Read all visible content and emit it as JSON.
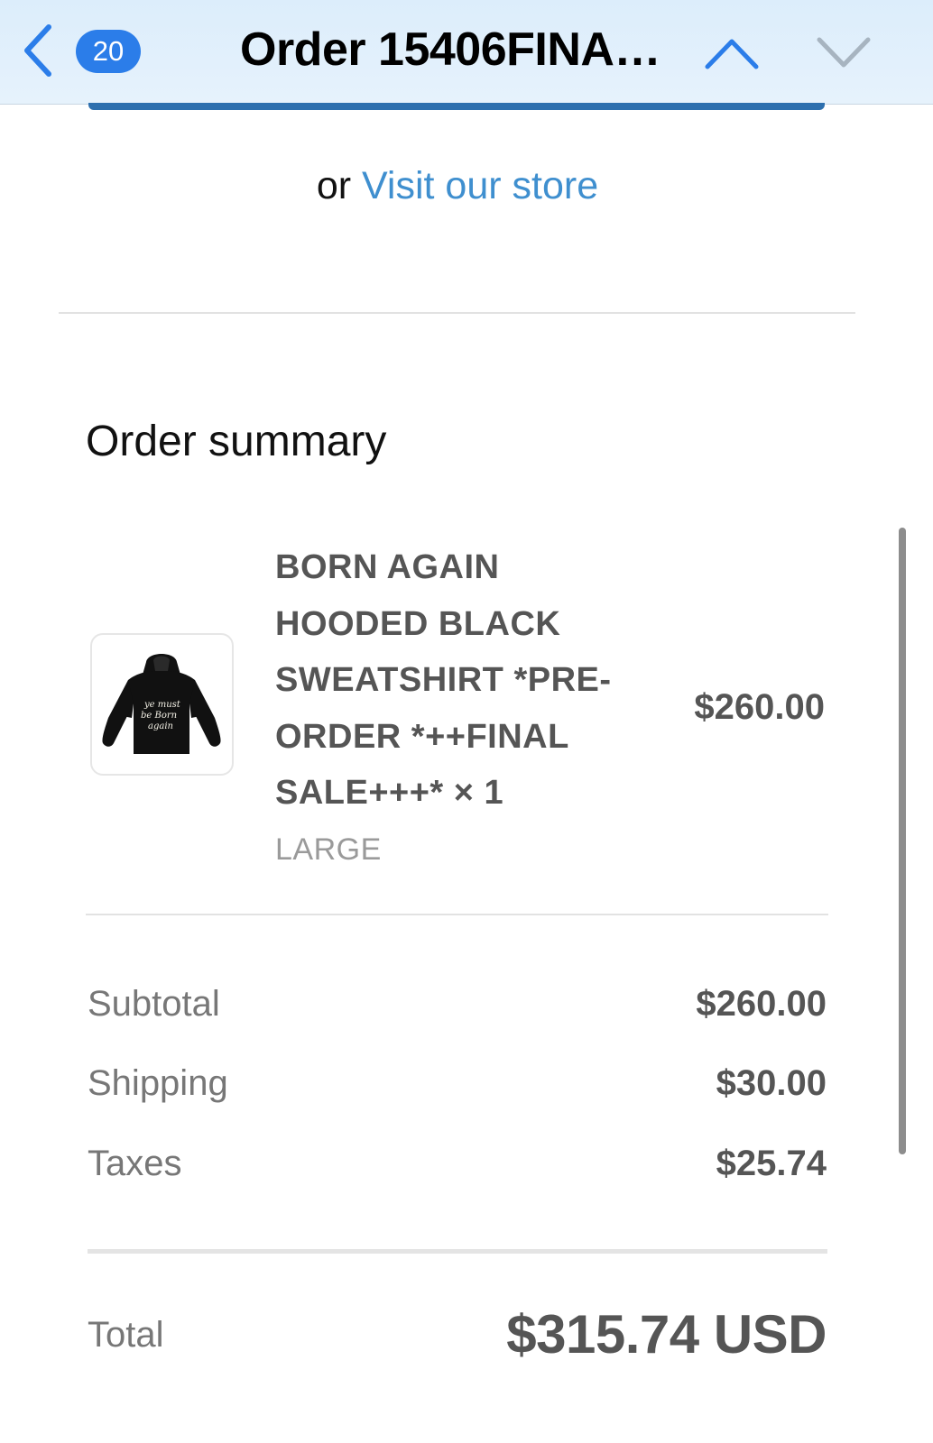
{
  "nav": {
    "unread_count": "20",
    "title": "Order 15406FINA…"
  },
  "store": {
    "or_text": "or",
    "link_text": "Visit our store"
  },
  "summary": {
    "title": "Order summary"
  },
  "item": {
    "name": "BORN AGAIN HOODED BLACK SWEATSHIRT *PRE-ORDER *++FINAL SALE+++* × 1",
    "variant": "LARGE",
    "price": "$260.00",
    "print_text": [
      "ye   must",
      "be Born",
      "again"
    ]
  },
  "costs": {
    "subtotal_label": "Subtotal",
    "subtotal_value": "$260.00",
    "shipping_label": "Shipping",
    "shipping_value": "$30.00",
    "taxes_label": "Taxes",
    "taxes_value": "$25.74"
  },
  "total": {
    "label": "Total",
    "value": "$315.74 USD"
  },
  "colors": {
    "accent": "#2b7de9",
    "link": "#3f8fcf",
    "nav_bg": "#dcedfb",
    "text_muted": "#777777",
    "text_strong": "#555555"
  },
  "icons": {
    "back": "chevron-left-icon",
    "prev": "chevron-up-icon",
    "next": "chevron-down-icon"
  }
}
